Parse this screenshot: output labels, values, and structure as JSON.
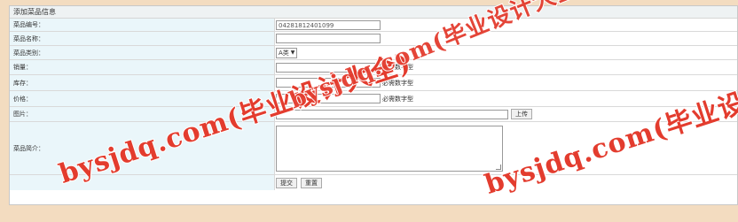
{
  "form": {
    "title": "添加菜品信息",
    "rows": [
      {
        "label": "菜品编号：",
        "value": "04281812401099"
      },
      {
        "label": "菜品名称：",
        "value": ""
      },
      {
        "label": "菜品类别：",
        "select": "A类"
      },
      {
        "label": "销量：",
        "value": "",
        "hint": "必需数字型"
      },
      {
        "label": "库存：",
        "value": "",
        "hint": "必需数字型"
      },
      {
        "label": "价格：",
        "value": "",
        "hint": "必需数字型"
      },
      {
        "label": "图片：",
        "value": "",
        "button": "上传"
      },
      {
        "label": "菜品简介：",
        "value": ""
      },
      {
        "label": "",
        "buttons": [
          "提交",
          "重置"
        ]
      }
    ]
  },
  "watermark": {
    "text": "bysjdq.com(毕业设计大全)",
    "text2": "bysjdq.com(毕业设计",
    "text3": "bysjdq.com(毕业设计大全)",
    "color": "#e33c2e"
  }
}
